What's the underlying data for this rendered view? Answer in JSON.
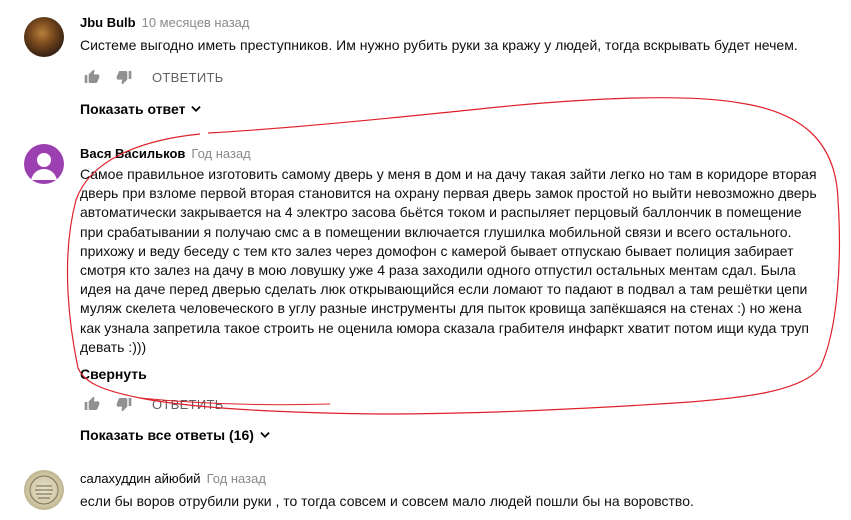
{
  "comments": [
    {
      "author": "Jbu Bulb",
      "time": "10 месяцев назад",
      "text": "Системе выгодно иметь преступников. Им нужно рубить руки за кражу у людей, тогда вскрывать будет нечем.",
      "reply_label": "ОТВЕТИТЬ",
      "show_replies_label": "Показать ответ"
    },
    {
      "author": "Вася Васильков",
      "time": "Год назад",
      "lines": [
        "Самое правильное изготовить самому дверь у меня в дом и на дачу такая зайти легко но там в коридоре вторая",
        "дверь при взломе первой вторая становится на охрану первая дверь замок простой но выйти невозможно дверь",
        "автоматически закрывается на 4 электро засова бьётся током и распыляет перцовый баллончик в помещение",
        "при срабатывании я получаю смс а в помещении включается глушилка мобильной связи и всего остального.",
        "прихожу  и веду беседу с тем кто залез через домофон с камерой бывает отпускаю бывает полиция забирает",
        "смотря кто залез на дачу в мою ловушку уже 4 раза заходили одного отпустил остальных ментам сдал. Была",
        "идея на даче перед дверью сделать люк открывающийся если ломают то падают в подвал а там решётки цепи",
        "муляж скелета человеческого в углу разные инструменты для пыток кровища запёкшаяся на стенах :) но жена",
        "как узнала запретила такое строить не оценила юмора сказала грабителя инфаркт хватит потом ищи куда труп",
        "девать :)))"
      ],
      "collapse_label": "Свернуть",
      "reply_label": "ОТВЕТИТЬ",
      "show_replies_label": "Показать все ответы (16)"
    },
    {
      "author": "салахуддин айюбий",
      "time": "Год назад",
      "text": "если бы воров отрубили руки , то тогда совсем и совсем мало людей пошли бы на воровство."
    }
  ],
  "colors": {
    "avatar_purple": "#9c3fb0",
    "scribble_red": "#e0212b",
    "meta_gray": "#606060"
  },
  "icons": [
    "thumb-up-icon",
    "thumb-down-icon",
    "chevron-down-icon"
  ]
}
